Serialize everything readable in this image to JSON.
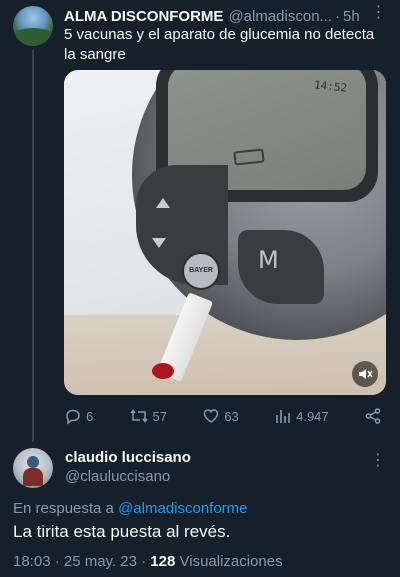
{
  "original_tweet": {
    "author_name": "ALMA DISCONFORME",
    "handle": "@almadiscon...",
    "separator": "·",
    "time_ago": "5h",
    "text": "5 vacunas y el aparato de glucemia no detecta la sangre",
    "media": {
      "type": "video",
      "screen_text": "14:52",
      "button_label": "M",
      "brand": "BAYER"
    },
    "actions": {
      "replies": "6",
      "retweets": "57",
      "likes": "63",
      "views": "4.947"
    }
  },
  "reply_tweet": {
    "author_name": "claudio luccisano",
    "handle": "@clauluccisano",
    "reply_prefix": "En respuesta a",
    "reply_to_handle": "@almadisconforme",
    "text": "La tirita esta puesta al revés.",
    "time": "18:03 · 25 may. 23 ·",
    "views_count": "128",
    "views_label": "Visualizaciones"
  },
  "colors": {
    "background": "#15202b",
    "text_primary": "#f7f9f9",
    "text_secondary": "#8b98a5",
    "accent": "#1d9bf0"
  }
}
